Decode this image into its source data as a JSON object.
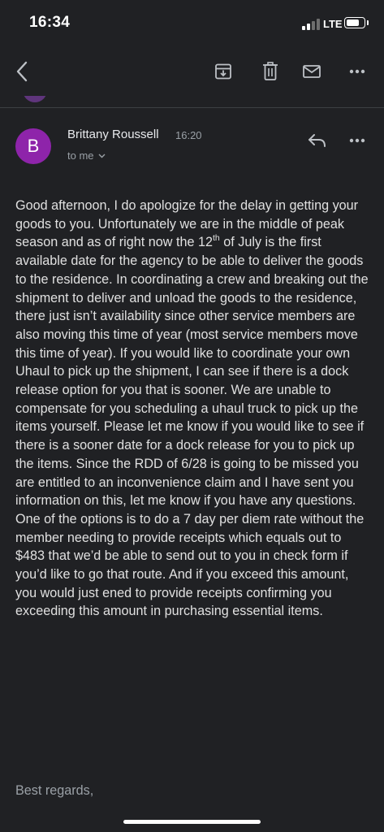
{
  "status_bar": {
    "time": "16:34",
    "network": "LTE",
    "signal_icon": "signal-bars-icon",
    "battery_icon": "battery-icon"
  },
  "toolbar": {
    "icons": [
      "back-chevron-icon",
      "archive-icon",
      "trash-icon",
      "mail-icon",
      "more-vert-icon"
    ]
  },
  "message": {
    "avatar_letter": "B",
    "avatar_color": "#8e24aa",
    "sender": "Brittany Roussell",
    "time": "16:20",
    "recipient": "to me",
    "body": {
      "p1": "Good afternoon, I do apologize for the delay in getting your goods to you. Unfortunately we are in the middle of peak season and as of right now the ",
      "date_num": "12",
      "date_sup": "th",
      "p2": " of July is the first available date for the agency to be able to deliver the goods to the residence. In coordinating a crew and breaking out the shipment to deliver and unload the goods to the residence, there just isn’t availability since other service members are also moving this time of year (most service members move this time of year). If you would like to coordinate your own Uhaul to pick up the shipment, I can see if there is a dock release option for you that is sooner. We are unable to compensate for you scheduling a uhaul truck to pick up the items yourself. Please let me know if you would like to see if there is a sooner date for a dock release for you to pick up the items. Since the RDD of 6/28 is going to be missed you are entitled to an inconvenience claim and I have sent you information on this, let me know if you have any questions. One of the options is to do a 7 day per diem rate without the member needing to provide receipts which equals out to $483 that we’d be able to send out to you in check form if you’d like to go that route. And if you exceed this amount, you would just ened to provide receipts confirming you exceeding this amount in purchasing essential items."
    },
    "signoff": "Best regards,"
  },
  "colors": {
    "background": "#202124",
    "text": "#e0e0e0",
    "secondary_text": "#9aa0a6"
  }
}
